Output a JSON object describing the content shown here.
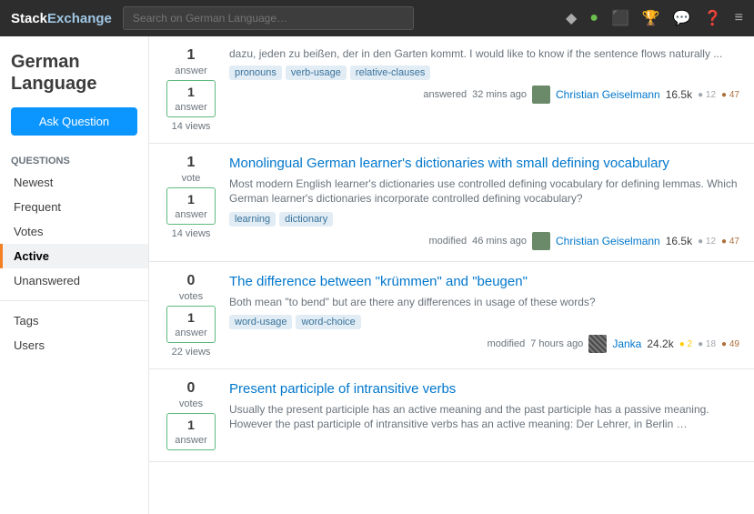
{
  "header": {
    "logo_stack": "Stack",
    "logo_exchange": "Exchange",
    "search_placeholder": "Search on German Language…",
    "icons": [
      "diamond",
      "circle-green",
      "inbox",
      "trophy",
      "chat",
      "help",
      "menu"
    ]
  },
  "sidebar": {
    "site_title": "German Language",
    "ask_button": "Ask Question",
    "nav_section": "Questions",
    "nav_items": [
      {
        "label": "Newest",
        "active": false
      },
      {
        "label": "Frequent",
        "active": false
      },
      {
        "label": "Votes",
        "active": false
      },
      {
        "label": "Active",
        "active": true
      },
      {
        "label": "Unanswered",
        "active": false
      }
    ],
    "other_items": [
      {
        "label": "Tags"
      },
      {
        "label": "Users"
      }
    ]
  },
  "questions": [
    {
      "votes": "1",
      "votes_label": "vote",
      "answers": "1",
      "answers_label": "answer",
      "views": "14 views",
      "title": "Monolingual German learner's dictionaries with small defining vocabulary",
      "excerpt": "Most modern English learner's dictionaries use controlled defining vocabulary for defining lemmas. Which German learner's dictionaries incorporate controlled defining vocabulary?",
      "tags": [
        "learning",
        "dictionary"
      ],
      "meta_action": "modified",
      "meta_time": "46 mins ago",
      "author": "Christian Geiselmann",
      "author_rep": "16.5k",
      "badge_gold": "",
      "badge_silver": "12",
      "badge_bronze": "47",
      "avatar_class": "avatar-christian"
    },
    {
      "votes": "0",
      "votes_label": "votes",
      "answers": "1",
      "answers_label": "answer",
      "views": "22 views",
      "title": "The difference between \"krümmen\" and \"beugen\"",
      "excerpt": "Both mean \"to bend\" but are there any differences in usage of these words?",
      "tags": [
        "word-usage",
        "word-choice"
      ],
      "meta_action": "modified",
      "meta_time": "7 hours ago",
      "author": "Janka",
      "author_rep": "24.2k",
      "badge_gold": "2",
      "badge_silver": "18",
      "badge_bronze": "49",
      "avatar_class": "avatar-janka"
    },
    {
      "votes": "0",
      "votes_label": "votes",
      "answers": "1",
      "answers_label": "answer",
      "views": "",
      "title": "Present participle of intransitive verbs",
      "excerpt": "Usually the present participle has an active meaning and the past participle has a passive meaning. However the past participle of intransitive verbs has an active meaning: Der Lehrer, in Berlin …",
      "tags": [],
      "meta_action": "",
      "meta_time": "",
      "author": "",
      "author_rep": "",
      "badge_gold": "",
      "badge_silver": "",
      "badge_bronze": "",
      "avatar_class": ""
    }
  ],
  "prev_question": {
    "votes": "1",
    "votes_label": "answer",
    "answers": "1",
    "answers_label": "answer",
    "views": "14 views",
    "tags": [
      "pronouns",
      "verb-usage",
      "relative-clauses"
    ],
    "meta_action": "answered",
    "meta_time": "32 mins ago",
    "author": "Christian Geiselmann",
    "author_rep": "16.5k",
    "badge_silver": "12",
    "badge_bronze": "47"
  }
}
